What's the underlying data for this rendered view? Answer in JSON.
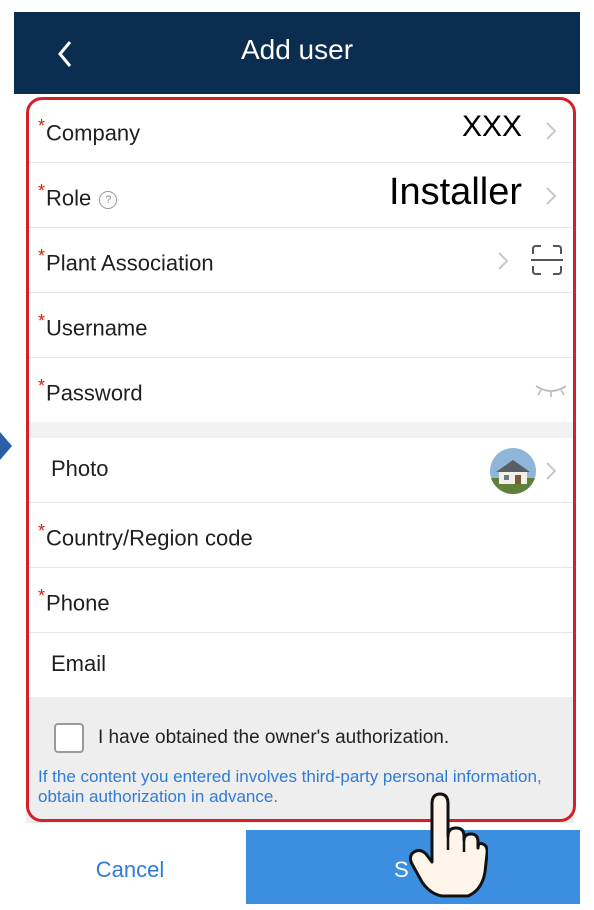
{
  "header": {
    "title": "Add user"
  },
  "form": {
    "required_mark": "*",
    "company": {
      "label": "Company",
      "value": "XXX"
    },
    "role": {
      "label": "Role",
      "value": "Installer",
      "help_icon": "?"
    },
    "plant_association": {
      "label": "Plant Association"
    },
    "username": {
      "label": "Username"
    },
    "password": {
      "label": "Password"
    },
    "photo": {
      "label": "Photo"
    },
    "country_code": {
      "label": "Country/Region code"
    },
    "phone": {
      "label": "Phone"
    },
    "email": {
      "label": "Email"
    }
  },
  "authorization": {
    "checkbox_label": "I have obtained the owner's authorization.",
    "notice": "If the content you entered involves third-party personal information, obtain authorization in advance."
  },
  "footer": {
    "cancel": "Cancel",
    "submit": "S"
  },
  "colors": {
    "header": "#0b2d4f",
    "required": "#d81e06",
    "link": "#2f7bd8",
    "primary": "#3c8fe0",
    "highlight": "#d42027"
  }
}
